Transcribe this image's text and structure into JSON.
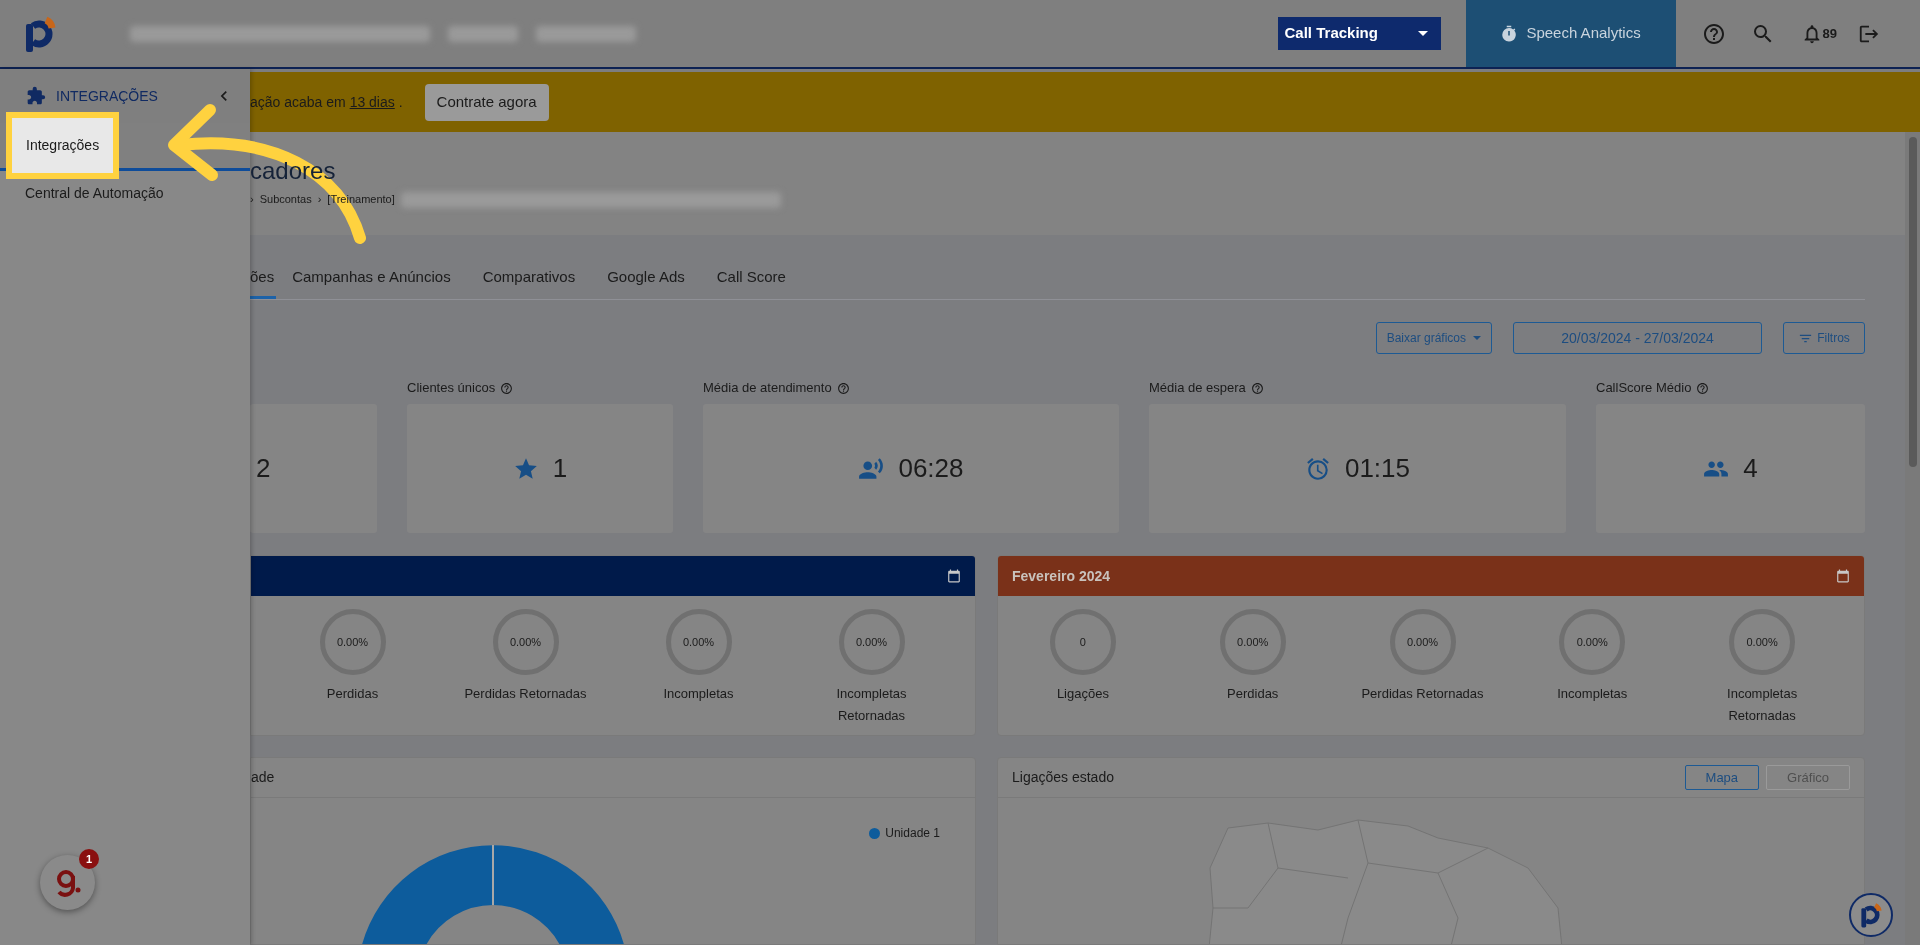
{
  "top_bar": {
    "product_select": "Call Tracking",
    "speech_analytics": "Speech Analytics",
    "notifications": "89"
  },
  "sidebar": {
    "title": "INTEGRAÇÕES",
    "items": [
      {
        "label": "Integrações",
        "selected": true
      },
      {
        "label": "Central de Automação",
        "selected": false
      }
    ]
  },
  "banner": {
    "text_before": "ação acaba em ",
    "link": "13 dias",
    "text_after": " .",
    "button": "Contrate agora"
  },
  "page": {
    "title": "cadores",
    "breadcrumb": [
      {
        "separator": "›",
        "label": "Subcontas"
      },
      {
        "separator": "›",
        "label": "[Treinamento]"
      }
    ]
  },
  "tabs": [
    {
      "label": "ões",
      "selected": true
    },
    {
      "label": "Campanhas e Anúncios",
      "selected": false
    },
    {
      "label": "Comparativos",
      "selected": false
    },
    {
      "label": "Google Ads",
      "selected": false
    },
    {
      "label": "Call Score",
      "selected": false
    }
  ],
  "toolbar": {
    "download": "Baixar gráficos",
    "date_range": "20/03/2024 - 27/03/2024",
    "filters": "Filtros"
  },
  "stats": [
    {
      "kind": "plain",
      "value": "2"
    },
    {
      "kind": "star",
      "label": "Clientes únicos",
      "value": "1"
    },
    {
      "kind": "voice",
      "label": "Média de atendimento",
      "value": "06:28"
    },
    {
      "kind": "alarm",
      "label": "Média de espera",
      "value": "01:15"
    },
    {
      "kind": "people",
      "label": "CallScore Médio",
      "value": "4"
    }
  ],
  "month_cards": [
    {
      "color": "#001a4a",
      "metrics": [
        {
          "value": "0.00%",
          "label": "Perdidas"
        },
        {
          "value": "0.00%",
          "label": "Perdidas Retornadas"
        },
        {
          "value": "0.00%",
          "label": "Incompletas"
        },
        {
          "value": "0.00%",
          "label": "Incompletas\nRetornadas"
        }
      ]
    },
    {
      "title": "Fevereiro 2024",
      "color": "#7a3119",
      "metrics": [
        {
          "value": "0",
          "label": "Ligações"
        },
        {
          "value": "0.00%",
          "label": "Perdidas"
        },
        {
          "value": "0.00%",
          "label": "Perdidas Retornadas"
        },
        {
          "value": "0.00%",
          "label": "Incompletas"
        },
        {
          "value": "0.00%",
          "label": "Incompletas\nRetornadas"
        }
      ]
    }
  ],
  "unit_chart": {
    "title": "ade",
    "legend": [
      {
        "label": "Unidade 1",
        "color": "#0d5c9c"
      }
    ]
  },
  "state_chart": {
    "title": "Ligações estado",
    "views": [
      {
        "label": "Mapa",
        "selected": true
      },
      {
        "label": "Gráfico",
        "selected": false
      }
    ]
  },
  "chat_badge": {
    "count": "1"
  }
}
